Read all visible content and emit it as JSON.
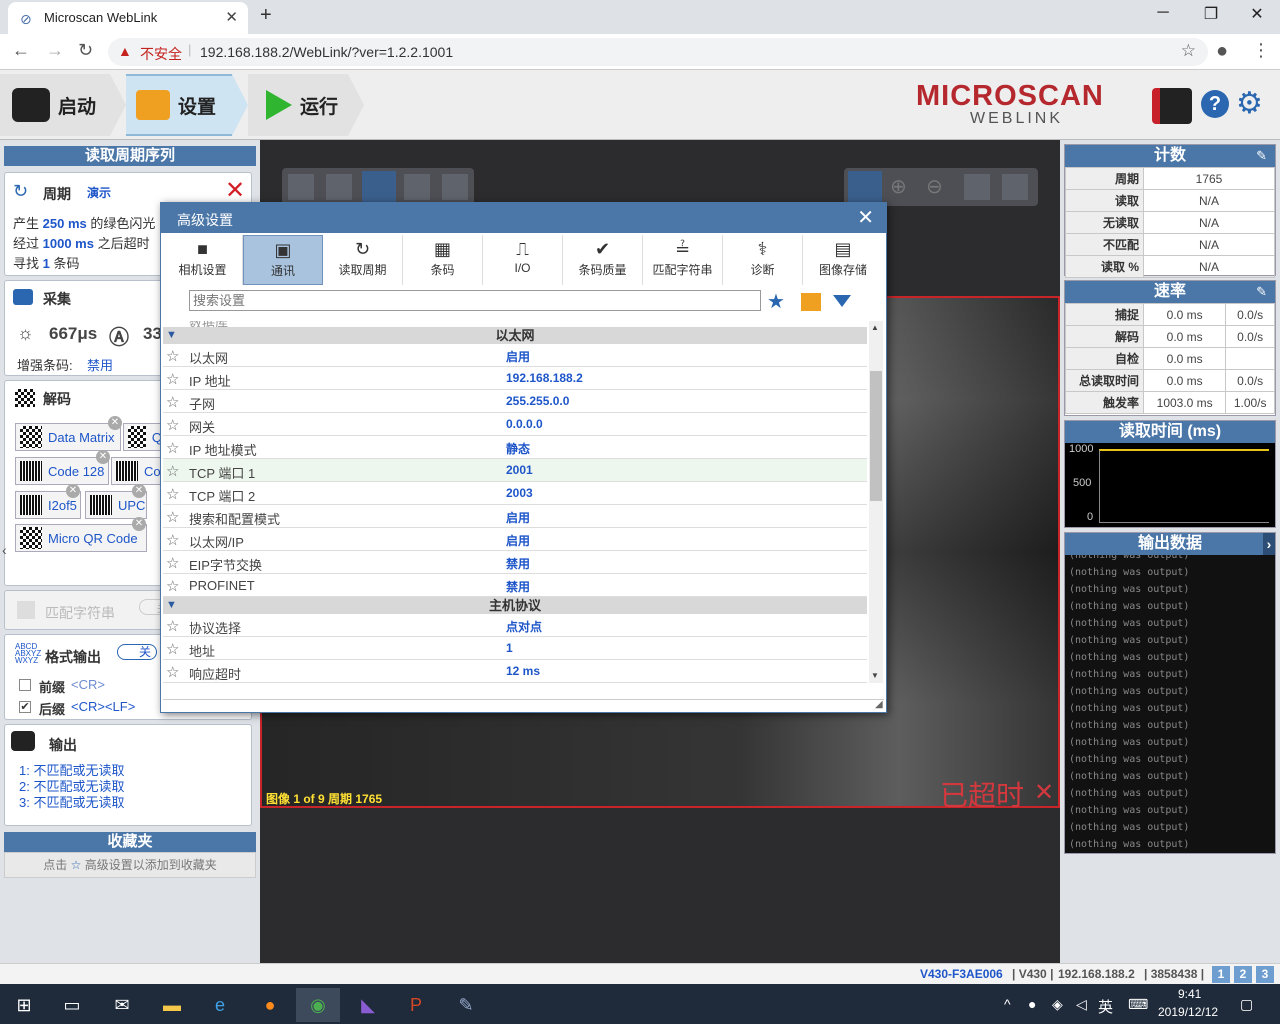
{
  "browser": {
    "tab_title": "Microscan WebLink",
    "not_secure": "不安全",
    "url": "192.168.188.2/WebLink/?ver=1.2.2.1001"
  },
  "nav": {
    "start": "启动",
    "setup": "设置",
    "run": "运行"
  },
  "brand": {
    "name": "MICROSCAN",
    "sub": "WEBLINK"
  },
  "left": {
    "cycle_title": "读取周期序列",
    "cycle": {
      "label": "周期",
      "mode": "演示",
      "line1_pre": "产生",
      "line1_val": "250 ms",
      "line1_post": "的绿色闪光",
      "line2_pre": "经过",
      "line2_val": "1000 ms",
      "line2_post": "之后超时",
      "line3_pre": "寻找",
      "line3_val": "1",
      "line3_post": "条码"
    },
    "capture": {
      "label": "采集",
      "exposure": "667μs",
      "gain": "33",
      "enhance_label": "增强条码:",
      "enhance_val": "禁用"
    },
    "decode": {
      "label": "解码",
      "symbols": [
        "Data Matrix",
        "Q",
        "Code 128",
        "Co",
        "I2of5",
        "UPC",
        "Micro QR Code"
      ]
    },
    "match": {
      "label": "匹配字符串",
      "toggle": "关"
    },
    "format": {
      "label": "格式输出",
      "toggle": "关",
      "prefix_label": "前缀",
      "prefix_val": "<CR>",
      "suffix_label": "后缀",
      "suffix_val": "<CR><LF>"
    },
    "output": {
      "label": "输出",
      "items": [
        "1: 不匹配或无读取",
        "2: 不匹配或无读取",
        "3: 不匹配或无读取"
      ]
    },
    "favorites": {
      "title": "收藏夹",
      "hint_pre": "点击",
      "hint_post": "高级设置以添加到收藏夹"
    }
  },
  "image": {
    "caption": "图像 1 of 9 周期 1765",
    "timeout": "已超时"
  },
  "dialog": {
    "title": "高级设置",
    "tabs": [
      "相机设置",
      "通讯",
      "读取周期",
      "条码",
      "I/O",
      "条码质量",
      "匹配字符串",
      "诊断",
      "图像存储"
    ],
    "search_placeholder": "搜索设置",
    "partial_row": "数据库",
    "groups": [
      {
        "title": "以太网",
        "rows": [
          {
            "k": "以太网",
            "v": "启用"
          },
          {
            "k": "IP 地址",
            "v": "192.168.188.2"
          },
          {
            "k": "子网",
            "v": "255.255.0.0"
          },
          {
            "k": "网关",
            "v": "0.0.0.0"
          },
          {
            "k": "IP 地址模式",
            "v": "静态"
          },
          {
            "k": "TCP 端口 1",
            "v": "2001"
          },
          {
            "k": "TCP 端口 2",
            "v": "2003"
          },
          {
            "k": "搜索和配置模式",
            "v": "启用"
          },
          {
            "k": "以太网/IP",
            "v": "启用"
          },
          {
            "k": "EIP字节交换",
            "v": "禁用"
          },
          {
            "k": "PROFINET",
            "v": "禁用"
          }
        ]
      },
      {
        "title": "主机协议",
        "rows": [
          {
            "k": "协议选择",
            "v": "点对点"
          },
          {
            "k": "地址",
            "v": "1"
          },
          {
            "k": "响应超时",
            "v": "12 ms"
          }
        ]
      }
    ]
  },
  "counts": {
    "title": "计数",
    "rows": [
      {
        "k": "周期",
        "v": "1765"
      },
      {
        "k": "读取",
        "v": "N/A"
      },
      {
        "k": "无读取",
        "v": "N/A"
      },
      {
        "k": "不匹配",
        "v": "N/A"
      },
      {
        "k": "读取 %",
        "v": "N/A"
      }
    ]
  },
  "rate": {
    "title": "速率",
    "rows": [
      {
        "k": "捕捉",
        "a": "0.0 ms",
        "b": "0.0/s"
      },
      {
        "k": "解码",
        "a": "0.0 ms",
        "b": "0.0/s"
      },
      {
        "k": "自检",
        "a": "0.0 ms",
        "b": ""
      },
      {
        "k": "总读取时间",
        "a": "0.0 ms",
        "b": "0.0/s"
      },
      {
        "k": "触发率",
        "a": "1003.0 ms",
        "b": "1.00/s"
      }
    ]
  },
  "read_time": {
    "title": "读取时间 (ms)",
    "ticks": [
      "1000",
      "500",
      "0"
    ]
  },
  "output_data": {
    "title": "输出数据",
    "line": "(nothing was output)"
  },
  "status": {
    "model": "V430-F3AE006",
    "series": "V430",
    "ip": "192.168.188.2",
    "serial": "3858438",
    "pages": [
      "1",
      "2",
      "3"
    ]
  },
  "taskbar": {
    "ime": "英",
    "time": "9:41",
    "date": "2019/12/12"
  },
  "colors": {
    "accent": "#4b77a8",
    "brand": "#b5282e",
    "link": "#1e56c9",
    "timeout": "#d2383e"
  }
}
